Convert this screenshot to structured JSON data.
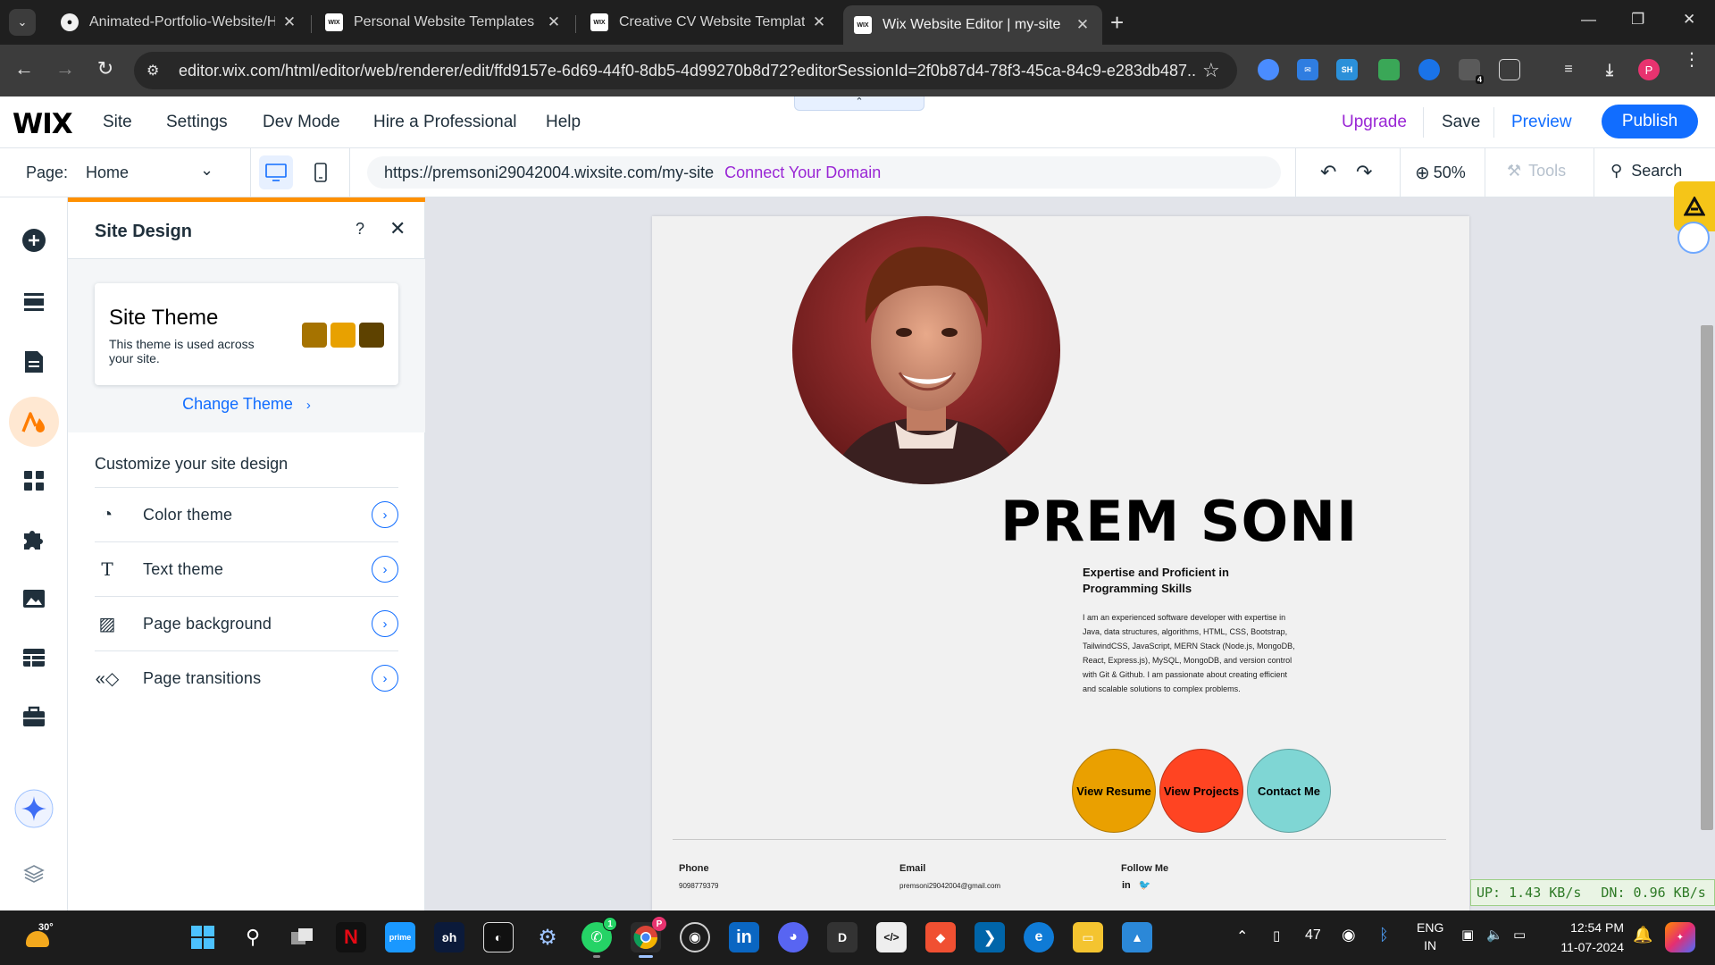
{
  "browser": {
    "tabs": [
      {
        "title": "Animated-Portfolio-Website/Home",
        "favicon": "github-icon",
        "active": false
      },
      {
        "title": "Personal Website Templates | Portfolio",
        "favicon": "wix-icon",
        "active": false
      },
      {
        "title": "Creative CV Website Template | WIX",
        "favicon": "wix-icon",
        "active": false
      },
      {
        "title": "Wix Website Editor | my-site",
        "favicon": "wix-icon",
        "active": true
      }
    ],
    "url": "editor.wix.com/html/editor/web/renderer/edit/ffd9157e-6d69-44f0-8db5-4d99270b8d72?editorSessionId=2f0b87d4-78f3-45ca-84c9-e283db487...",
    "extensions": [
      "SH"
    ],
    "extension_badge": "4",
    "profile_initial": "P"
  },
  "wix": {
    "logo": "WIX",
    "menu": [
      "Site",
      "Settings",
      "Dev Mode",
      "Hire a Professional",
      "Help"
    ],
    "upgrade": "Upgrade",
    "save": "Save",
    "preview": "Preview",
    "publish": "Publish",
    "page_label": "Page:",
    "page_value": "Home",
    "site_url": "https://premsoni29042004.wixsite.com/my-site",
    "connect_domain": "Connect Your Domain",
    "zoom": "50%",
    "tools": "Tools",
    "search": "Search"
  },
  "panel": {
    "title": "Site Design",
    "help": "?",
    "theme_title": "Site Theme",
    "theme_desc": "This theme is used across your site.",
    "swatches": [
      "#a67300",
      "#e8a100",
      "#5e4200"
    ],
    "change_theme": "Change Theme",
    "customize_heading": "Customize your site design",
    "options": [
      {
        "label": "Color theme",
        "icon": "droplet-icon"
      },
      {
        "label": "Text theme",
        "icon": "text-icon"
      },
      {
        "label": "Page background",
        "icon": "background-icon"
      },
      {
        "label": "Page transitions",
        "icon": "transition-icon"
      }
    ]
  },
  "site": {
    "name": "PREM SONI",
    "subheading": "Expertise and Proficient in Programming Skills",
    "bio": "I am an experienced software developer with expertise in Java, data structures, algorithms, HTML, CSS, Bootstrap, TailwindCSS, JavaScript, MERN Stack (Node.js, MongoDB, React, Express.js), MySQL, MongoDB, and version control with Git & Github. I am passionate about creating efficient and scalable solutions to complex problems.",
    "buttons": [
      {
        "label": "View Resume",
        "color": "#eaa000"
      },
      {
        "label": "View Projects",
        "color": "#ff4422"
      },
      {
        "label": "Contact Me",
        "color": "#7fd6d4"
      }
    ],
    "footer": {
      "phone_label": "Phone",
      "phone": "9098779379",
      "email_label": "Email",
      "email": "premsoni29042004@gmail.com",
      "follow_label": "Follow Me",
      "social": [
        "in",
        "twitter"
      ]
    }
  },
  "network": {
    "up": "UP: 1.43 KB/s",
    "down": "DN: 0.96 KB/s"
  },
  "taskbar": {
    "weather_temp": "30°",
    "whatsapp_badge": "1",
    "tray_number": "47",
    "lang": "ENG",
    "region": "IN",
    "time": "12:54 PM",
    "date": "11-07-2024"
  }
}
